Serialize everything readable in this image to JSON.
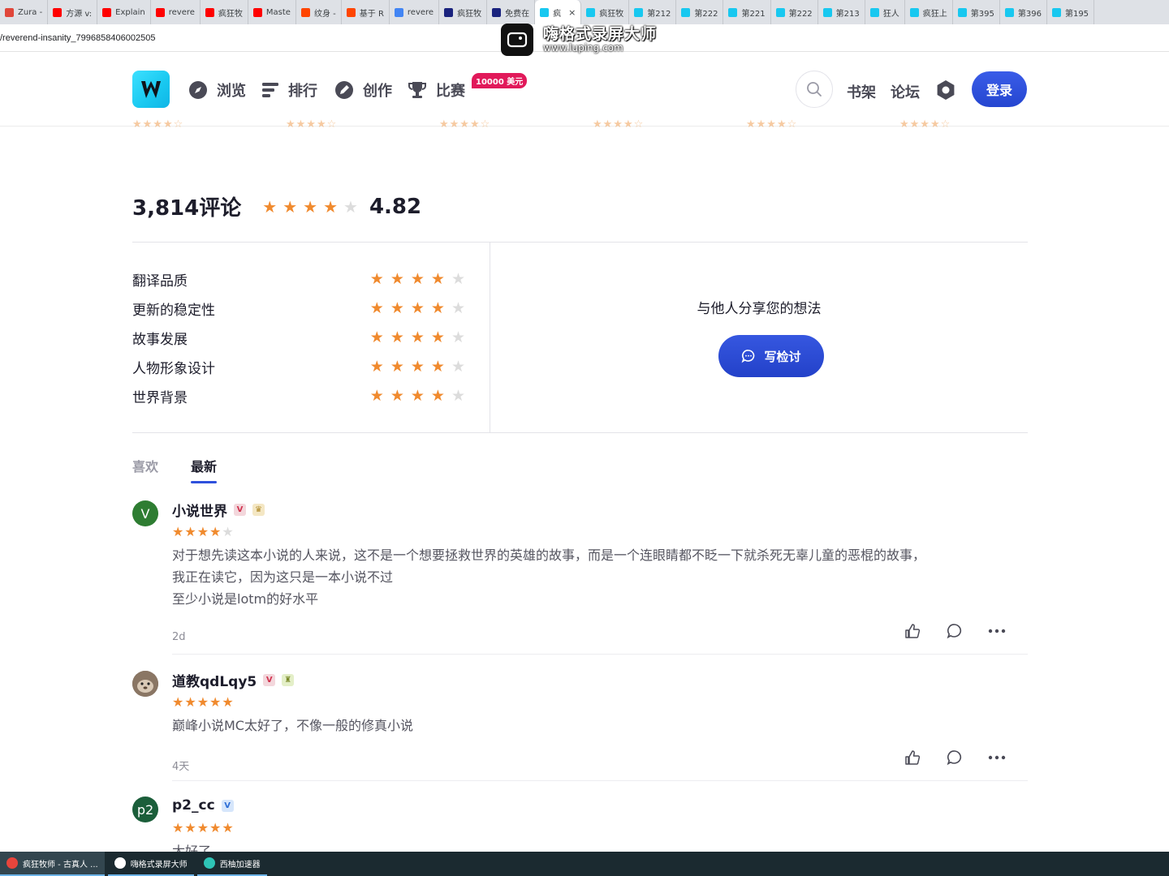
{
  "browser": {
    "tabs": [
      {
        "label": "Zura -",
        "color": "#e0463a"
      },
      {
        "label": "方源 v:",
        "color": "#ff0000"
      },
      {
        "label": "Explain",
        "color": "#ff0000"
      },
      {
        "label": "revere",
        "color": "#ff0000"
      },
      {
        "label": "疯狂牧",
        "color": "#ff0000"
      },
      {
        "label": "Maste",
        "color": "#ff0000"
      },
      {
        "label": "纹身 -",
        "color": "#ff4500"
      },
      {
        "label": "基于 R",
        "color": "#ff4500"
      },
      {
        "label": "revere",
        "color": "#4285f4"
      },
      {
        "label": "疯狂牧",
        "color": "#1a237e"
      },
      {
        "label": "免费在",
        "color": "#1a237e"
      },
      {
        "label": "疯",
        "color": "#18c8f0"
      },
      {
        "label": "疯狂牧",
        "color": "#18c8f0"
      },
      {
        "label": "第212",
        "color": "#18c8f0"
      },
      {
        "label": "第222",
        "color": "#18c8f0"
      },
      {
        "label": "第221",
        "color": "#18c8f0"
      },
      {
        "label": "第222",
        "color": "#18c8f0"
      },
      {
        "label": "第213",
        "color": "#18c8f0"
      },
      {
        "label": "狂人",
        "color": "#18c8f0"
      },
      {
        "label": "疯狂上",
        "color": "#18c8f0"
      },
      {
        "label": "第395",
        "color": "#18c8f0"
      },
      {
        "label": "第396",
        "color": "#18c8f0"
      },
      {
        "label": "第195",
        "color": "#18c8f0"
      }
    ],
    "active_tab_index": 11,
    "close_glyph": "×",
    "url": "/reverend-insanity_7996858406002505"
  },
  "watermark": {
    "title": "嗨格式录屏大师",
    "subtitle": "www.luping.com"
  },
  "header": {
    "logo_letter": "W",
    "nav": [
      {
        "label": "浏览",
        "icon": "compass-icon"
      },
      {
        "label": "排行",
        "icon": "ranking-icon"
      },
      {
        "label": "创作",
        "icon": "pen-icon"
      },
      {
        "label": "比赛",
        "icon": "trophy-icon"
      }
    ],
    "contest_badge": "10000 美元",
    "bookshelf": "书架",
    "forum": "论坛",
    "login": "登录"
  },
  "summary": {
    "count": "3,814",
    "count_suffix": "评论",
    "score": "4.82",
    "stars_filled": 4
  },
  "ratings": [
    {
      "label": "翻译品质",
      "stars": 4
    },
    {
      "label": "更新的稳定性",
      "stars": 4
    },
    {
      "label": "故事发展",
      "stars": 4
    },
    {
      "label": "人物形象设计",
      "stars": 4
    },
    {
      "label": "世界背景",
      "stars": 4
    }
  ],
  "share": {
    "prompt": "与他人分享您的想法",
    "button": "写检讨"
  },
  "sort_tabs": {
    "likes": "喜欢",
    "latest": "最新",
    "active": "latest"
  },
  "reviews": [
    {
      "user": "小说世界",
      "avatar_letter": "V",
      "avatar_color": "#2e7d32",
      "stars": 4,
      "lines": [
        "对于想先读这本小说的人来说，这不是一个想要拯救世界的英雄的故事，而是一个连眼睛都不眨一下就杀死无辜儿童的恶棍的故事，",
        "我正在读它，因为这只是一本小说不过",
        "至少小说是lotm的好水平"
      ],
      "time": "2d"
    },
    {
      "user": "道教qdLqy5",
      "avatar_letter": "",
      "avatar_color": "#7a6a5c",
      "stars": 5,
      "lines": [
        "巅峰小说MC太好了，不像一般的修真小说"
      ],
      "time": "4天"
    },
    {
      "user": "p2_cc",
      "avatar_letter": "p2",
      "avatar_color": "#1b5e3a",
      "stars": 5,
      "lines": [
        "太好了"
      ],
      "time": ""
    }
  ],
  "taskbar": {
    "items": [
      {
        "label": "疯狂牧师 - 古真人 ...",
        "color": "#e8453c"
      },
      {
        "label": "嗨格式录屏大师",
        "color": "#ffffff"
      },
      {
        "label": "西柚加速器",
        "color": "#2ec4b6"
      }
    ]
  }
}
